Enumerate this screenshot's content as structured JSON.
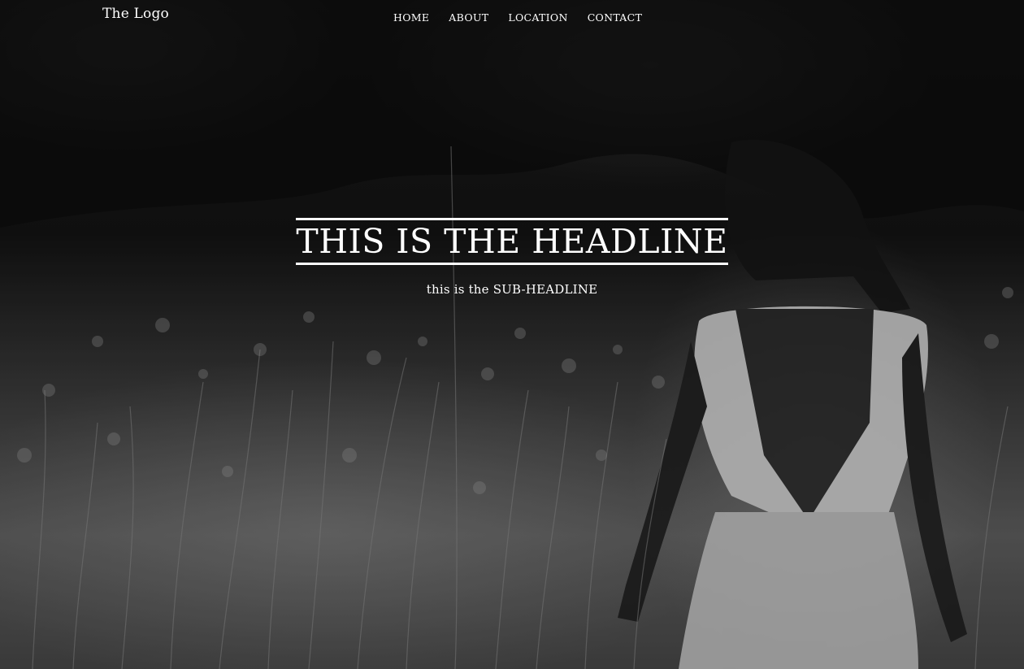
{
  "header": {
    "logo": "The Logo",
    "nav": [
      {
        "label": "HOME"
      },
      {
        "label": "ABOUT"
      },
      {
        "label": "LOCATION"
      },
      {
        "label": "CONTACT"
      }
    ]
  },
  "hero": {
    "headline": "THIS IS THE HEADLINE",
    "subheadline": "this is the SUB-HEADLINE",
    "colors": {
      "text": "#ffffff",
      "background_tone": "grayscale"
    }
  }
}
